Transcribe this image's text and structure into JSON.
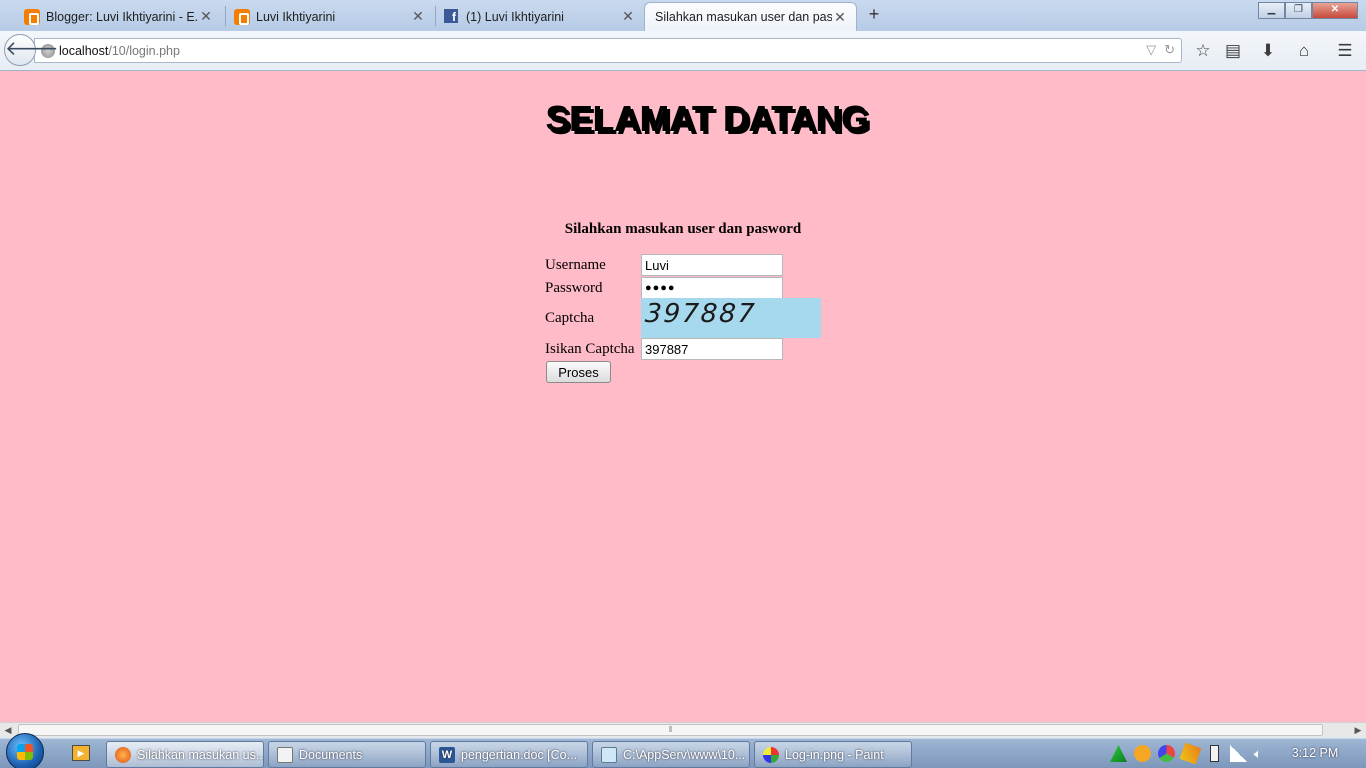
{
  "browser": {
    "tabs": [
      {
        "title": "Blogger: Luvi Ikhtiyarini - E...",
        "icon": "blogger-icon",
        "active": false
      },
      {
        "title": "Luvi Ikhtiyarini",
        "icon": "blogger-icon",
        "active": false
      },
      {
        "title": "(1) Luvi Ikhtiyarini",
        "icon": "facebook-icon",
        "active": false
      },
      {
        "title": "Silahkan masukan user dan pas...",
        "icon": "none",
        "active": true
      }
    ],
    "close_glyph": "✕",
    "new_tab_glyph": "+",
    "url_host": "localhost",
    "url_path": "/10/login.php",
    "window_buttons": {
      "minimize": "▁",
      "maximize": "❐",
      "close": "✕"
    }
  },
  "page": {
    "heading": "SELAMAT DATANG",
    "form_title": "Silahkan masukan user dan pasword",
    "username_label": "Username",
    "username_value": "Luvi",
    "password_label": "Password",
    "password_value": "●●●●",
    "captcha_label": "Captcha",
    "captcha_image_text": "397887",
    "captcha_input_label": "Isikan Captcha",
    "captcha_input_value": "397887",
    "submit_label": "Proses",
    "background_color": "#ffbbc8",
    "captcha_bg_color": "#a6d8ee"
  },
  "taskbar": {
    "items": [
      {
        "label": "Silahkan masukan us...",
        "icon": "firefox-icon",
        "active": true
      },
      {
        "label": "Documents",
        "icon": "folder-icon",
        "active": false
      },
      {
        "label": "pengertian.doc [Co...",
        "icon": "word-icon",
        "active": false
      },
      {
        "label": "C:\\AppServ\\www\\10...",
        "icon": "notepad-icon",
        "active": false
      },
      {
        "label": "Log-in.png - Paint",
        "icon": "paint-icon",
        "active": false
      }
    ],
    "clock": "3:12 PM"
  }
}
